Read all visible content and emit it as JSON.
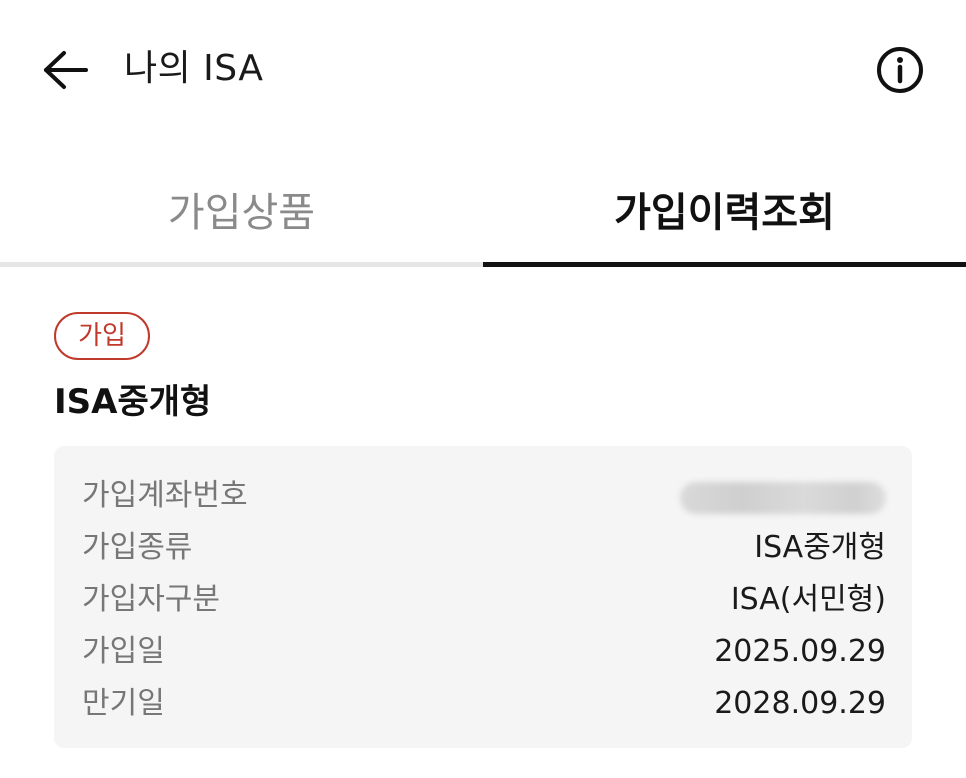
{
  "header": {
    "title": "나의 ISA",
    "back_icon": "arrow-left-icon",
    "info_icon": "info-circle-icon"
  },
  "tabs": [
    {
      "label": "가입상품",
      "selected": false
    },
    {
      "label": "가입이력조회",
      "selected": true
    }
  ],
  "card": {
    "status_badge": "가입",
    "status_color": "#c0392b",
    "product_name": "ISA중개형",
    "details": [
      {
        "label": "가입계좌번호",
        "value": "",
        "masked": true
      },
      {
        "label": "가입종류",
        "value": "ISA중개형"
      },
      {
        "label": "가입자구분",
        "value": "ISA(서민형)"
      },
      {
        "label": "가입일",
        "value": "2025.09.29"
      },
      {
        "label": "만기일",
        "value": "2028.09.29"
      }
    ]
  }
}
